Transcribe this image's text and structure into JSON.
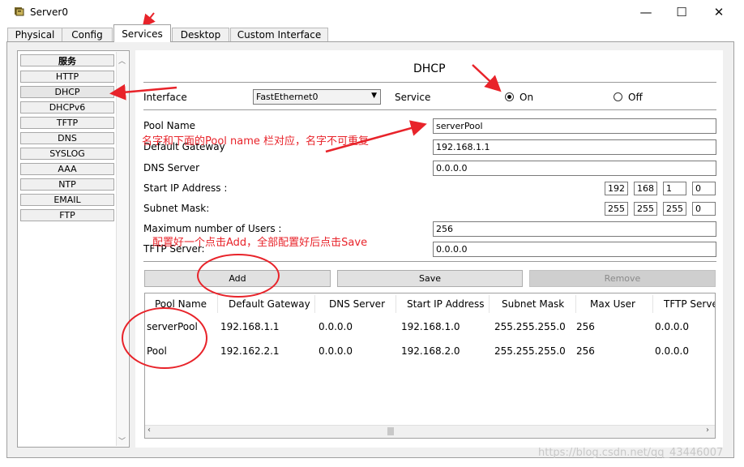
{
  "window": {
    "title": "Server0",
    "minimize": "—",
    "maximize": "☐",
    "close": "✕"
  },
  "tabs": [
    "Physical",
    "Config",
    "Services",
    "Desktop",
    "Custom Interface"
  ],
  "sidebar": {
    "header": "服务",
    "items": [
      "HTTP",
      "DHCP",
      "DHCPv6",
      "TFTP",
      "DNS",
      "SYSLOG",
      "AAA",
      "NTP",
      "EMAIL",
      "FTP"
    ]
  },
  "dhcp": {
    "title": "DHCP",
    "interface_label": "Interface",
    "interface_value": "FastEthernet0",
    "service_label": "Service",
    "on_label": "On",
    "off_label": "Off",
    "pool_name_label": "Pool Name",
    "pool_name_value": "serverPool",
    "gateway_label": "Default Gateway",
    "gateway_value": "192.168.1.1",
    "dns_label": "DNS Server",
    "dns_value": "0.0.0.0",
    "start_ip_label": "Start IP Address :",
    "start_ip": [
      "192",
      "168",
      "1",
      "0"
    ],
    "subnet_label": "Subnet Mask:",
    "subnet": [
      "255",
      "255",
      "255",
      "0"
    ],
    "max_users_label": "Maximum number of Users :",
    "max_users_value": "256",
    "tftp_label": "TFTP Server:",
    "tftp_value": "0.0.0.0",
    "add_label": "Add",
    "save_label": "Save",
    "remove_label": "Remove"
  },
  "table": {
    "headers": [
      "Pool Name",
      "Default Gateway",
      "DNS Server",
      "Start IP Address",
      "Subnet Mask",
      "Max User",
      "TFTP Serve"
    ],
    "rows": [
      [
        "serverPool",
        "192.168.1.1",
        "0.0.0.0",
        "192.168.1.0",
        "255.255.255.0",
        "256",
        "0.0.0.0"
      ],
      [
        "Pool",
        "192.162.2.1",
        "0.0.0.0",
        "192.168.2.0",
        "255.255.255.0",
        "256",
        "0.0.0.0"
      ]
    ]
  },
  "annotations": {
    "note1": "名字和下面的Pool name 栏对应，名字不可重复",
    "note2": "配置好一个点击Add，全部配置好后点击Save"
  },
  "watermark": "https://blog.csdn.net/qq_43446007",
  "colors": {
    "annotation": "#e8232a",
    "panel": "#f0f0f0"
  }
}
